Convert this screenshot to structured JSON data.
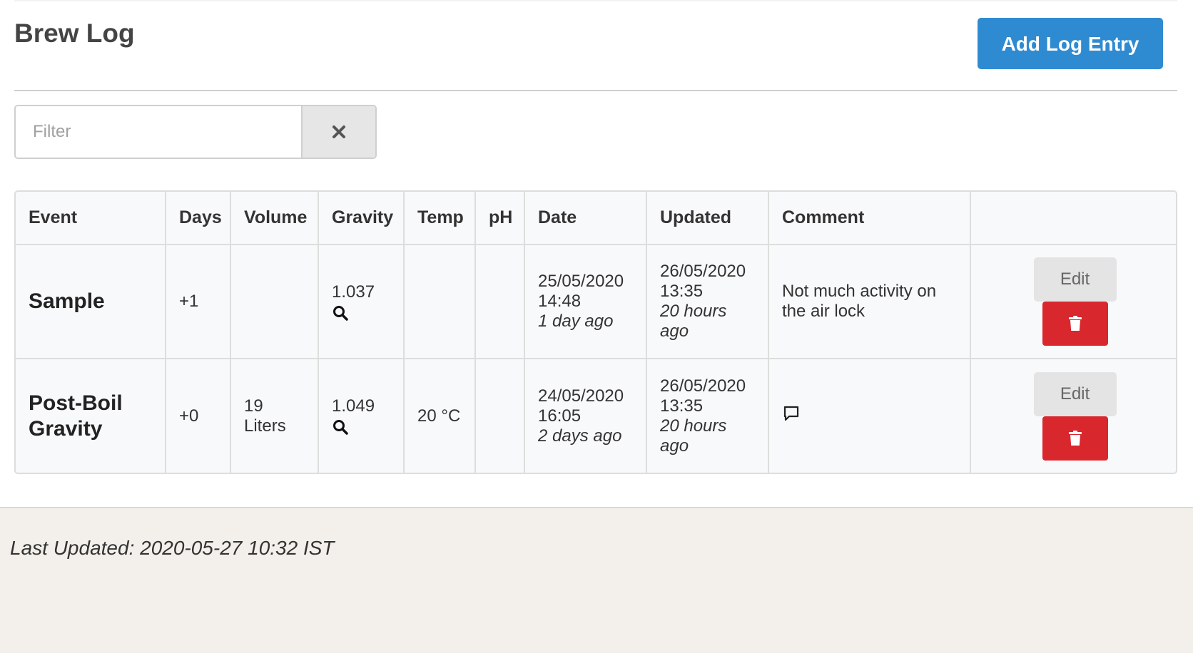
{
  "header": {
    "title": "Brew Log",
    "add_entry_label": "Add Log Entry"
  },
  "filter": {
    "placeholder": "Filter",
    "value": ""
  },
  "table": {
    "columns": [
      "Event",
      "Days",
      "Volume",
      "Gravity",
      "Temp",
      "pH",
      "Date",
      "Updated",
      "Comment",
      ""
    ],
    "rows": [
      {
        "event": "Sample",
        "days": "+1",
        "volume": "",
        "gravity": "1.037",
        "gravity_icon": "search-icon",
        "temp": "",
        "ph": "",
        "date": "25/05/2020",
        "time": "14:48",
        "date_relative": "1 day ago",
        "updated_date": "26/05/2020",
        "updated_time": "13:35",
        "updated_relative": "20 hours ago",
        "comment": "Not much activity on the air lock",
        "comment_icon": "",
        "edit_label": "Edit",
        "delete_icon": "trash-icon"
      },
      {
        "event": "Post-Boil Gravity",
        "days": "+0",
        "volume": "19 Liters",
        "gravity": "1.049",
        "gravity_icon": "search-icon",
        "temp": "20 °C",
        "ph": "",
        "date": "24/05/2020",
        "time": "16:05",
        "date_relative": "2 days ago",
        "updated_date": "26/05/2020",
        "updated_time": "13:35",
        "updated_relative": "20 hours ago",
        "comment": "",
        "comment_icon": "comment-icon",
        "edit_label": "Edit",
        "delete_icon": "trash-icon"
      }
    ]
  },
  "footer": {
    "last_updated": "Last Updated: 2020-05-27 10:32 IST"
  },
  "colors": {
    "primary": "#2f8bd1",
    "danger": "#d9272e",
    "footer_bg": "#f3f0eb",
    "edit_bg": "#e4e4e4"
  }
}
